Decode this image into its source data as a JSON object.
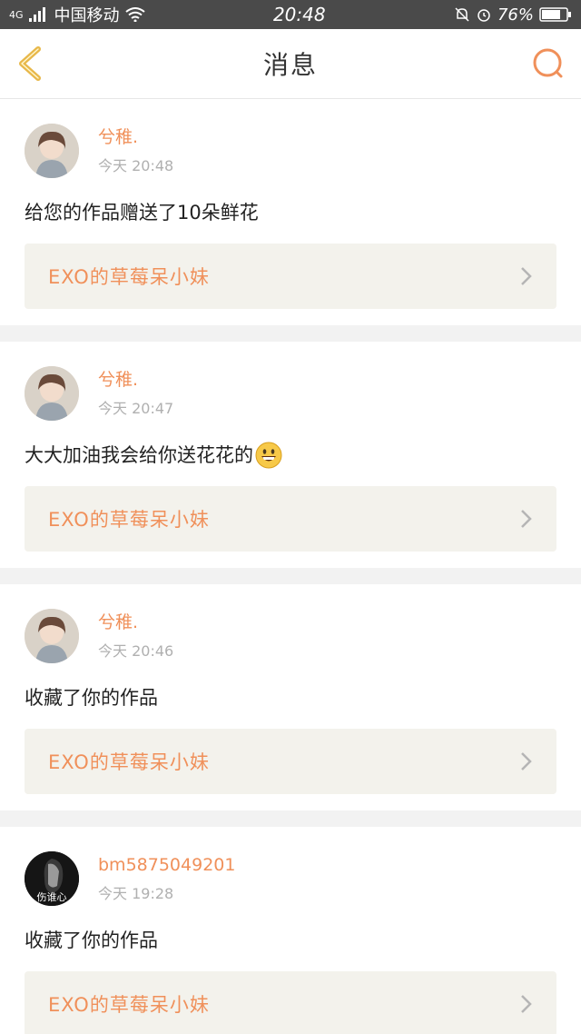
{
  "status_bar": {
    "carrier": "中国移动",
    "network": "4G",
    "time": "20:48",
    "battery": "76%"
  },
  "header": {
    "title": "消息"
  },
  "colors": {
    "accent": "#f0905a",
    "back": "#e8b84a",
    "status_bar": "#4a4a4a"
  },
  "messages": [
    {
      "username": "兮稚.",
      "time": "今天 20:48",
      "text": "给您的作品赠送了10朵鲜花",
      "work": "EXO的草莓呆小妹",
      "avatar": "girl-avatar"
    },
    {
      "username": "兮稚.",
      "time": "今天 20:47",
      "text": "大大加油我会给你送花花的",
      "work": "EXO的草莓呆小妹",
      "avatar": "girl-avatar",
      "emoji": "grinning-face"
    },
    {
      "username": "兮稚.",
      "time": "今天 20:46",
      "text": "收藏了你的作品",
      "work": "EXO的草莓呆小妹",
      "avatar": "girl-avatar"
    },
    {
      "username": "bm5875049201",
      "time": "今天 19:28",
      "text": "收藏了你的作品",
      "work": "EXO的草莓呆小妹",
      "avatar": "dark-avatar",
      "avatar_text": "伤谁心"
    }
  ]
}
